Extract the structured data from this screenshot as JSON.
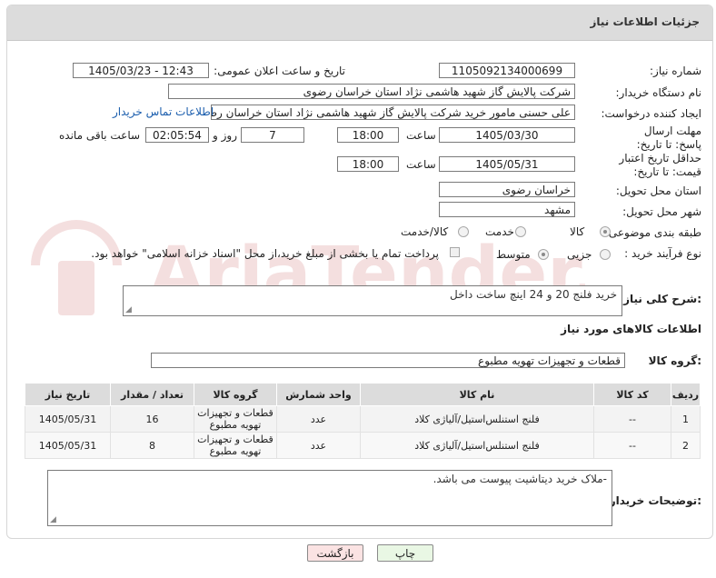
{
  "header": {
    "title": "جزئیات اطلاعات نیاز"
  },
  "fields": {
    "need_number_label": "شماره نیاز:",
    "need_number": "1105092134000699",
    "announce_label": "تاریخ و ساعت اعلان عمومی:",
    "announce_value": "1405/03/23 - 12:43",
    "buyer_org_label": "نام دستگاه خریدار:",
    "buyer_org": "شرکت پالایش گاز شهید هاشمی نژاد   استان خراسان رضوی",
    "creator_label": "ایجاد کننده درخواست:",
    "creator": "علی حسنی مامور خرید شرکت پالایش گاز شهید هاشمی نژاد   استان خراسان رضوی",
    "contact_link": "اطلاعات تماس خریدار",
    "deadline_label": "مهلت ارسال پاسخ: تا تاریخ:",
    "deadline_date": "1405/03/30",
    "time_label": "ساعت",
    "deadline_time": "18:00",
    "days_value": "7",
    "days_label": "روز و",
    "remaining_time": "02:05:54",
    "remaining_label": "ساعت باقی مانده",
    "min_price_label": "حداقل تاریخ اعتبار قیمت: تا تاریخ:",
    "min_price_date": "1405/05/31",
    "min_price_time": "18:00",
    "delivery_province_label": "استان محل تحویل:",
    "delivery_province": "خراسان رضوی",
    "delivery_city_label": "شهر محل تحویل:",
    "delivery_city": "مشهد",
    "category_label": "طبقه بندی موضوعی:",
    "category_options": [
      "کالا",
      "خدمت",
      "کالا/خدمت"
    ],
    "process_label": "نوع فرآیند خرید :",
    "process_options": [
      "جزیی",
      "متوسط"
    ],
    "payment_note": "پرداخت تمام یا بخشی از مبلغ خرید،از محل \"اسناد خزانه اسلامی\" خواهد بود."
  },
  "description": {
    "label": "شرح کلی نیاز:",
    "value": "خرید فلنج 20 و 24 اینچ ساخت داخل"
  },
  "goods_section": {
    "title": "اطلاعات کالاهای مورد نیاز",
    "group_label": "گروه کالا:",
    "group_value": "قطعات و تجهیزات تهویه مطبوع"
  },
  "table": {
    "headers": [
      "ردیف",
      "کد کالا",
      "نام کالا",
      "واحد شمارش",
      "گروه کالا",
      "تعداد / مقدار",
      "تاریخ نیاز"
    ],
    "rows": [
      [
        "1",
        "--",
        "فلنج استنلس‌استیل/آلیاژی کلاد",
        "عدد",
        "قطعات و تجهیزات تهویه مطبوع",
        "16",
        "1405/05/31"
      ],
      [
        "2",
        "--",
        "فلنج استنلس‌استیل/آلیاژی کلاد",
        "عدد",
        "قطعات و تجهیزات تهویه مطبوع",
        "8",
        "1405/05/31"
      ]
    ]
  },
  "buyer_notes": {
    "label": "توضیحات خریدار:",
    "value": "-ملاک خرید دیتاشیت پیوست می باشد."
  },
  "buttons": {
    "print": "چاپ",
    "back": "بازگشت"
  },
  "watermark": {
    "text": "AriaTender.net"
  }
}
